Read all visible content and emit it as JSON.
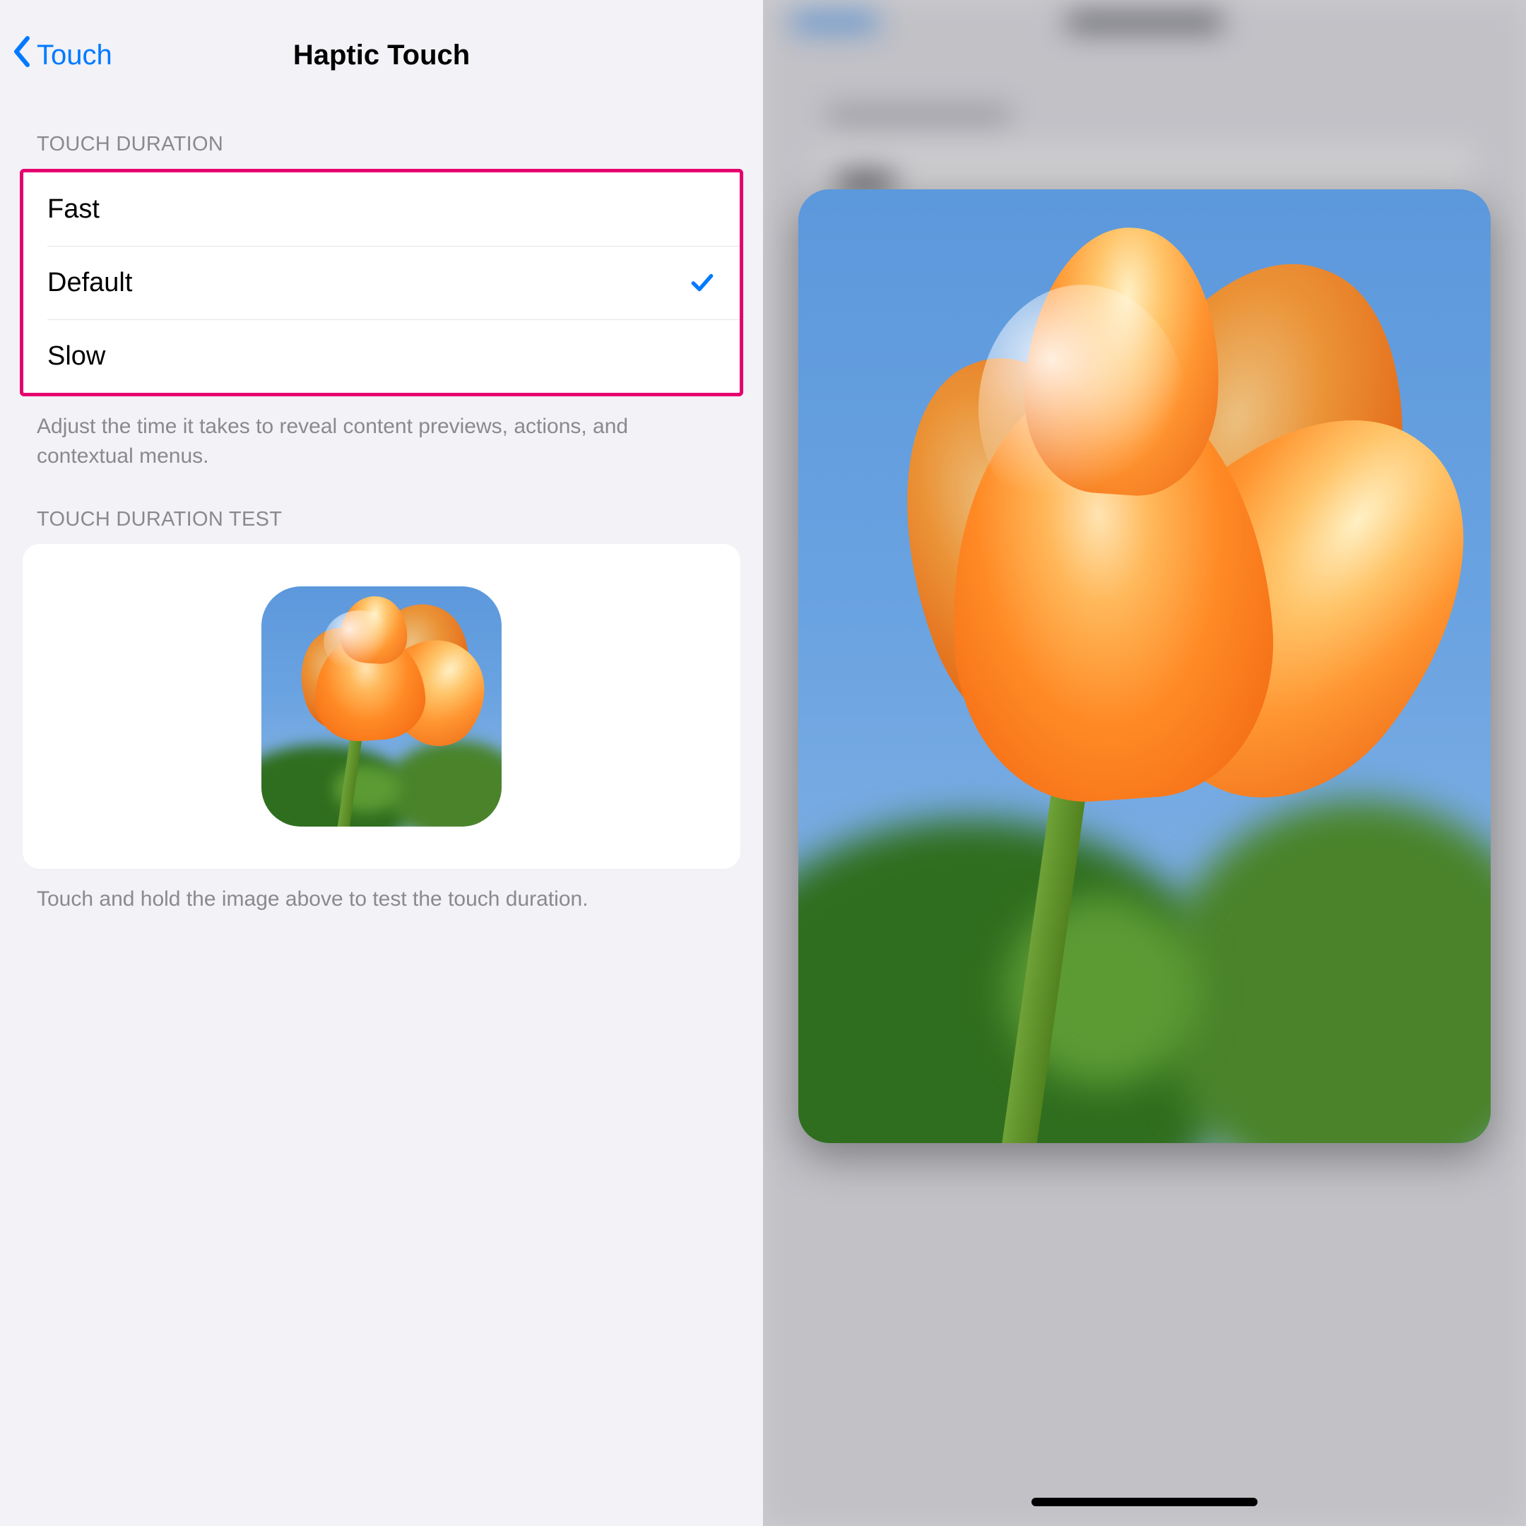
{
  "nav": {
    "back_label": "Touch",
    "title": "Haptic Touch"
  },
  "touch_duration": {
    "header": "TOUCH DURATION",
    "options": [
      {
        "label": "Fast",
        "selected": false
      },
      {
        "label": "Default",
        "selected": true
      },
      {
        "label": "Slow",
        "selected": false
      }
    ],
    "footer": "Adjust the time it takes to reveal content previews, actions, and contextual menus."
  },
  "touch_test": {
    "header": "TOUCH DURATION TEST",
    "footer": "Touch and hold the image above to test the touch duration."
  },
  "colors": {
    "accent": "#007AFF",
    "highlight_border": "#E6006F"
  }
}
